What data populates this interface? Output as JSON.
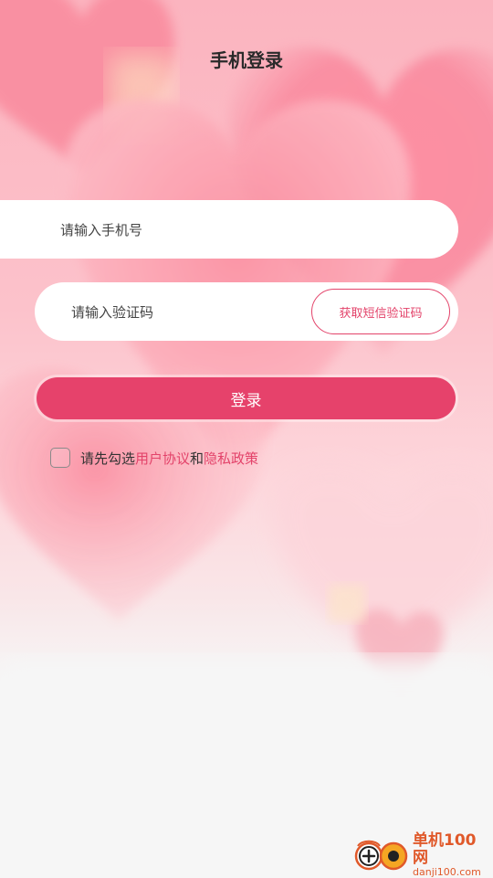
{
  "page": {
    "title": "手机登录"
  },
  "form": {
    "phone_placeholder": "请输入手机号",
    "code_placeholder": "请输入验证码",
    "sms_button_label": "获取短信验证码",
    "login_button_label": "登录"
  },
  "agreement": {
    "checked": false,
    "prefix": "请先勾选",
    "user_agreement": "用户协议",
    "conjunction": "和",
    "privacy_policy": "隐私政策"
  },
  "watermark": {
    "name": "单机100网",
    "url": "danji100.com"
  },
  "colors": {
    "accent": "#e6426b",
    "link": "#e3436a",
    "background_top": "#fbb4bf",
    "background_bottom": "#f6f6f6",
    "watermark": "#e0592a"
  },
  "icons": {
    "checkbox": "checkbox-icon",
    "watermark_logo": "danji-logo-icon"
  }
}
